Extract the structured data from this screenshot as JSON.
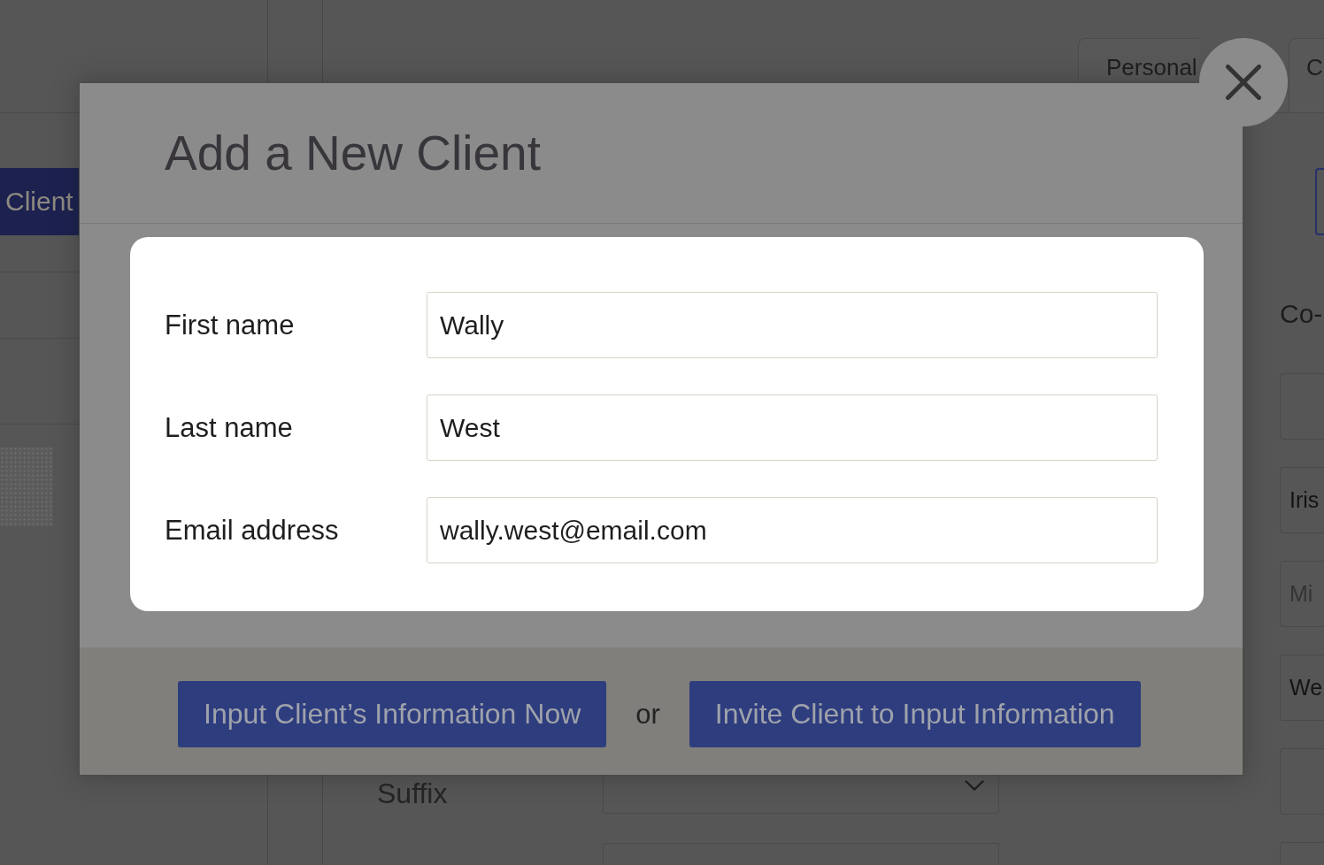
{
  "background": {
    "sidebar": {
      "button": "Client"
    },
    "tabs": [
      {
        "label": "Personal"
      },
      {
        "label": "C"
      }
    ],
    "form_rows": [
      {
        "kind": "dropdown",
        "label": "Suffix"
      },
      {
        "kind": "field"
      }
    ],
    "side_label": "Co-",
    "side_fields": [
      {
        "kind": "empty"
      },
      {
        "kind": "filled",
        "value": "Iris"
      },
      {
        "kind": "hint",
        "placeholder": "Mi"
      },
      {
        "kind": "filled",
        "value": "We"
      },
      {
        "kind": "empty"
      },
      {
        "kind": "empty"
      }
    ]
  },
  "modal": {
    "title": "Add a New Client",
    "fields": [
      {
        "label": "First name",
        "value": "Wally"
      },
      {
        "label": "Last name",
        "value": "West"
      },
      {
        "label": "Email address",
        "value": "wally.west@email.com"
      }
    ],
    "actions": [
      {
        "label": "Input Client’s Information Now"
      },
      {
        "label": "Invite Client to Input Information"
      }
    ],
    "separator": "or"
  }
}
